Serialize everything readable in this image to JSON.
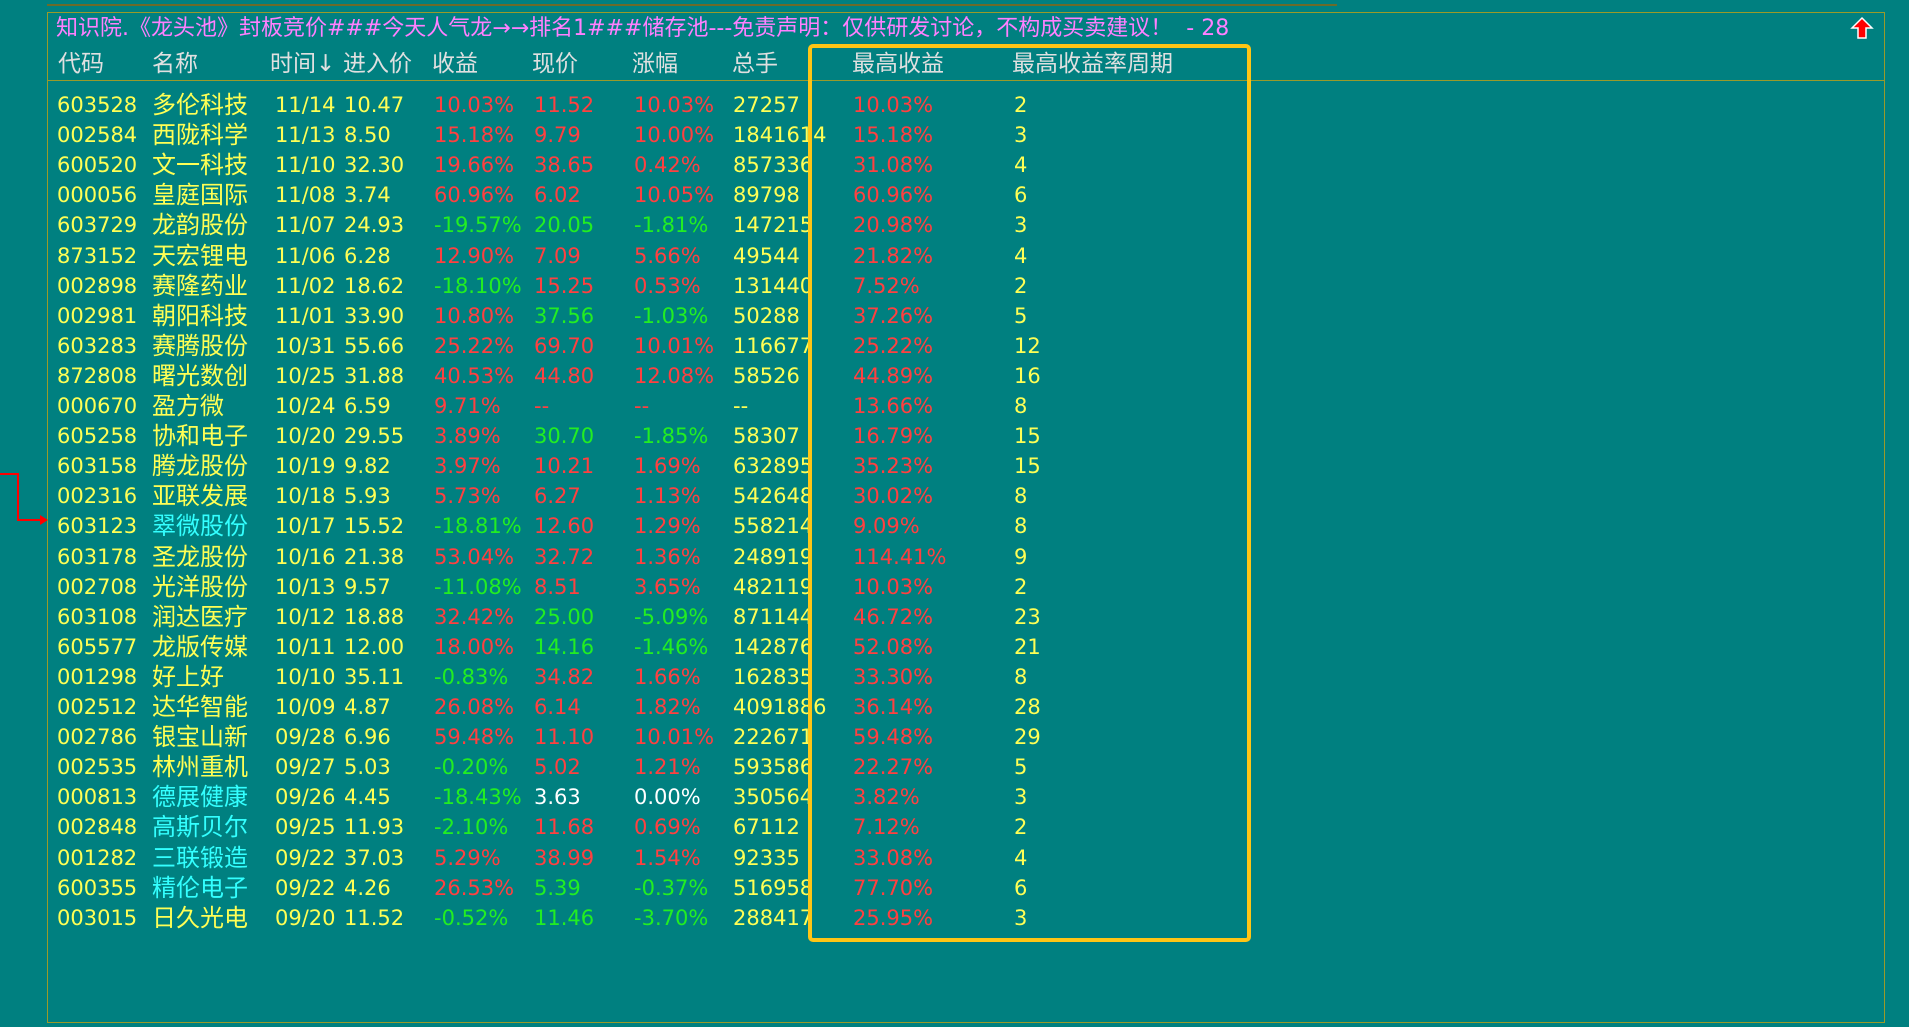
{
  "title": {
    "text": "知识院.《龙头池》封板竞价###今天人气龙→→排名1###储存池---免责声明：仅供研发讨论，不构成买卖建议！",
    "count": "- 28"
  },
  "icons": {
    "scroll_up": "up-arrow-icon",
    "row_marker": "row-marker-icon"
  },
  "colors": {
    "background": "#008080",
    "highlight_box": "#ffc515",
    "positive": "#ff4040",
    "negative": "#22ee22",
    "code": "#ffff55",
    "title": "#ff80ff"
  },
  "columns": [
    "代码",
    "名称",
    "时间↓",
    "进入价",
    "收益",
    "现价",
    "涨幅",
    "总手",
    "最高收益",
    "最高收益率周期"
  ],
  "rows": [
    {
      "code": "603528",
      "name": "多伦科技",
      "time": "11/14",
      "entry": "10.47",
      "gain": "10.03%",
      "price": "11.52",
      "change": "10.03%",
      "volume": "27257",
      "max_gain": "10.03%",
      "period": "2",
      "gain_c": "red",
      "price_c": "red",
      "change_c": "red",
      "name_c": "yellow"
    },
    {
      "code": "002584",
      "name": "西陇科学",
      "time": "11/13",
      "entry": "8.50",
      "gain": "15.18%",
      "price": "9.79",
      "change": "10.00%",
      "volume": "1841614",
      "max_gain": "15.18%",
      "period": "3",
      "gain_c": "red",
      "price_c": "red",
      "change_c": "red",
      "name_c": "yellow"
    },
    {
      "code": "600520",
      "name": "文一科技",
      "time": "11/10",
      "entry": "32.30",
      "gain": "19.66%",
      "price": "38.65",
      "change": "0.42%",
      "volume": "857336",
      "max_gain": "31.08%",
      "period": "4",
      "gain_c": "red",
      "price_c": "red",
      "change_c": "red",
      "name_c": "yellow"
    },
    {
      "code": "000056",
      "name": "皇庭国际",
      "time": "11/08",
      "entry": "3.74",
      "gain": "60.96%",
      "price": "6.02",
      "change": "10.05%",
      "volume": "89798",
      "max_gain": "60.96%",
      "period": "6",
      "gain_c": "red",
      "price_c": "red",
      "change_c": "red",
      "name_c": "yellow"
    },
    {
      "code": "603729",
      "name": "龙韵股份",
      "time": "11/07",
      "entry": "24.93",
      "gain": "-19.57%",
      "price": "20.05",
      "change": "-1.81%",
      "volume": "147215",
      "max_gain": "20.98%",
      "period": "3",
      "gain_c": "green",
      "price_c": "green",
      "change_c": "green",
      "name_c": "yellow"
    },
    {
      "code": "873152",
      "name": "天宏锂电",
      "time": "11/06",
      "entry": "6.28",
      "gain": "12.90%",
      "price": "7.09",
      "change": "5.66%",
      "volume": "49544",
      "max_gain": "21.82%",
      "period": "4",
      "gain_c": "red",
      "price_c": "red",
      "change_c": "red",
      "name_c": "yellow"
    },
    {
      "code": "002898",
      "name": "赛隆药业",
      "time": "11/02",
      "entry": "18.62",
      "gain": "-18.10%",
      "price": "15.25",
      "change": "0.53%",
      "volume": "131440",
      "max_gain": "7.52%",
      "period": "2",
      "gain_c": "green",
      "price_c": "red",
      "change_c": "red",
      "name_c": "yellow"
    },
    {
      "code": "002981",
      "name": "朝阳科技",
      "time": "11/01",
      "entry": "33.90",
      "gain": "10.80%",
      "price": "37.56",
      "change": "-1.03%",
      "volume": "50288",
      "max_gain": "37.26%",
      "period": "5",
      "gain_c": "red",
      "price_c": "green",
      "change_c": "green",
      "name_c": "yellow"
    },
    {
      "code": "603283",
      "name": "赛腾股份",
      "time": "10/31",
      "entry": "55.66",
      "gain": "25.22%",
      "price": "69.70",
      "change": "10.01%",
      "volume": "116677",
      "max_gain": "25.22%",
      "period": "12",
      "gain_c": "red",
      "price_c": "red",
      "change_c": "red",
      "name_c": "yellow"
    },
    {
      "code": "872808",
      "name": "曙光数创",
      "time": "10/25",
      "entry": "31.88",
      "gain": "40.53%",
      "price": "44.80",
      "change": "12.08%",
      "volume": "58526",
      "max_gain": "44.89%",
      "period": "16",
      "gain_c": "red",
      "price_c": "red",
      "change_c": "red",
      "name_c": "yellow"
    },
    {
      "code": "000670",
      "name": "盈方微",
      "time": "10/24",
      "entry": "6.59",
      "gain": "9.71%",
      "price": "--",
      "change": "--",
      "volume": "--",
      "max_gain": "13.66%",
      "period": "8",
      "gain_c": "red",
      "price_c": "red",
      "change_c": "red",
      "name_c": "yellow"
    },
    {
      "code": "605258",
      "name": "协和电子",
      "time": "10/20",
      "entry": "29.55",
      "gain": "3.89%",
      "price": "30.70",
      "change": "-1.85%",
      "volume": "58307",
      "max_gain": "16.79%",
      "period": "15",
      "gain_c": "red",
      "price_c": "green",
      "change_c": "green",
      "name_c": "yellow"
    },
    {
      "code": "603158",
      "name": "腾龙股份",
      "time": "10/19",
      "entry": "9.82",
      "gain": "3.97%",
      "price": "10.21",
      "change": "1.69%",
      "volume": "632895",
      "max_gain": "35.23%",
      "period": "15",
      "gain_c": "red",
      "price_c": "red",
      "change_c": "red",
      "name_c": "yellow"
    },
    {
      "code": "002316",
      "name": "亚联发展",
      "time": "10/18",
      "entry": "5.93",
      "gain": "5.73%",
      "price": "6.27",
      "change": "1.13%",
      "volume": "542648",
      "max_gain": "30.02%",
      "period": "8",
      "gain_c": "red",
      "price_c": "red",
      "change_c": "red",
      "name_c": "yellow"
    },
    {
      "code": "603123",
      "name": "翠微股份",
      "time": "10/17",
      "entry": "15.52",
      "gain": "-18.81%",
      "price": "12.60",
      "change": "1.29%",
      "volume": "558214",
      "max_gain": "9.09%",
      "period": "8",
      "gain_c": "green",
      "price_c": "red",
      "change_c": "red",
      "name_c": "cyan"
    },
    {
      "code": "603178",
      "name": "圣龙股份",
      "time": "10/16",
      "entry": "21.38",
      "gain": "53.04%",
      "price": "32.72",
      "change": "1.36%",
      "volume": "248919",
      "max_gain": "114.41%",
      "period": "9",
      "gain_c": "red",
      "price_c": "red",
      "change_c": "red",
      "name_c": "yellow"
    },
    {
      "code": "002708",
      "name": "光洋股份",
      "time": "10/13",
      "entry": "9.57",
      "gain": "-11.08%",
      "price": "8.51",
      "change": "3.65%",
      "volume": "482119",
      "max_gain": "10.03%",
      "period": "2",
      "gain_c": "green",
      "price_c": "red",
      "change_c": "red",
      "name_c": "yellow"
    },
    {
      "code": "603108",
      "name": "润达医疗",
      "time": "10/12",
      "entry": "18.88",
      "gain": "32.42%",
      "price": "25.00",
      "change": "-5.09%",
      "volume": "871144",
      "max_gain": "46.72%",
      "period": "23",
      "gain_c": "red",
      "price_c": "green",
      "change_c": "green",
      "name_c": "yellow"
    },
    {
      "code": "605577",
      "name": "龙版传媒",
      "time": "10/11",
      "entry": "12.00",
      "gain": "18.00%",
      "price": "14.16",
      "change": "-1.46%",
      "volume": "142876",
      "max_gain": "52.08%",
      "period": "21",
      "gain_c": "red",
      "price_c": "green",
      "change_c": "green",
      "name_c": "yellow"
    },
    {
      "code": "001298",
      "name": "好上好",
      "time": "10/10",
      "entry": "35.11",
      "gain": "-0.83%",
      "price": "34.82",
      "change": "1.66%",
      "volume": "162835",
      "max_gain": "33.30%",
      "period": "8",
      "gain_c": "green",
      "price_c": "red",
      "change_c": "red",
      "name_c": "yellow"
    },
    {
      "code": "002512",
      "name": "达华智能",
      "time": "10/09",
      "entry": "4.87",
      "gain": "26.08%",
      "price": "6.14",
      "change": "1.82%",
      "volume": "4091886",
      "max_gain": "36.14%",
      "period": "28",
      "gain_c": "red",
      "price_c": "red",
      "change_c": "red",
      "name_c": "yellow"
    },
    {
      "code": "002786",
      "name": "银宝山新",
      "time": "09/28",
      "entry": "6.96",
      "gain": "59.48%",
      "price": "11.10",
      "change": "10.01%",
      "volume": "222671",
      "max_gain": "59.48%",
      "period": "29",
      "gain_c": "red",
      "price_c": "red",
      "change_c": "red",
      "name_c": "yellow"
    },
    {
      "code": "002535",
      "name": "林州重机",
      "time": "09/27",
      "entry": "5.03",
      "gain": "-0.20%",
      "price": "5.02",
      "change": "1.21%",
      "volume": "593586",
      "max_gain": "22.27%",
      "period": "5",
      "gain_c": "green",
      "price_c": "red",
      "change_c": "red",
      "name_c": "yellow"
    },
    {
      "code": "000813",
      "name": "德展健康",
      "time": "09/26",
      "entry": "4.45",
      "gain": "-18.43%",
      "price": "3.63",
      "change": "0.00%",
      "volume": "350564",
      "max_gain": "3.82%",
      "period": "3",
      "gain_c": "green",
      "price_c": "white",
      "change_c": "white",
      "name_c": "cyan"
    },
    {
      "code": "002848",
      "name": "高斯贝尔",
      "time": "09/25",
      "entry": "11.93",
      "gain": "-2.10%",
      "price": "11.68",
      "change": "0.69%",
      "volume": "67112",
      "max_gain": "7.12%",
      "period": "2",
      "gain_c": "green",
      "price_c": "red",
      "change_c": "red",
      "name_c": "cyan"
    },
    {
      "code": "001282",
      "name": "三联锻造",
      "time": "09/22",
      "entry": "37.03",
      "gain": "5.29%",
      "price": "38.99",
      "change": "1.54%",
      "volume": "92335",
      "max_gain": "33.08%",
      "period": "4",
      "gain_c": "red",
      "price_c": "red",
      "change_c": "red",
      "name_c": "cyan"
    },
    {
      "code": "600355",
      "name": "精伦电子",
      "time": "09/22",
      "entry": "4.26",
      "gain": "26.53%",
      "price": "5.39",
      "change": "-0.37%",
      "volume": "516958",
      "max_gain": "77.70%",
      "period": "6",
      "gain_c": "red",
      "price_c": "green",
      "change_c": "green",
      "name_c": "cyan"
    },
    {
      "code": "003015",
      "name": "日久光电",
      "time": "09/20",
      "entry": "11.52",
      "gain": "-0.52%",
      "price": "11.46",
      "change": "-3.70%",
      "volume": "288417",
      "max_gain": "25.95%",
      "period": "3",
      "gain_c": "green",
      "price_c": "green",
      "change_c": "green",
      "name_c": "yellow"
    }
  ]
}
